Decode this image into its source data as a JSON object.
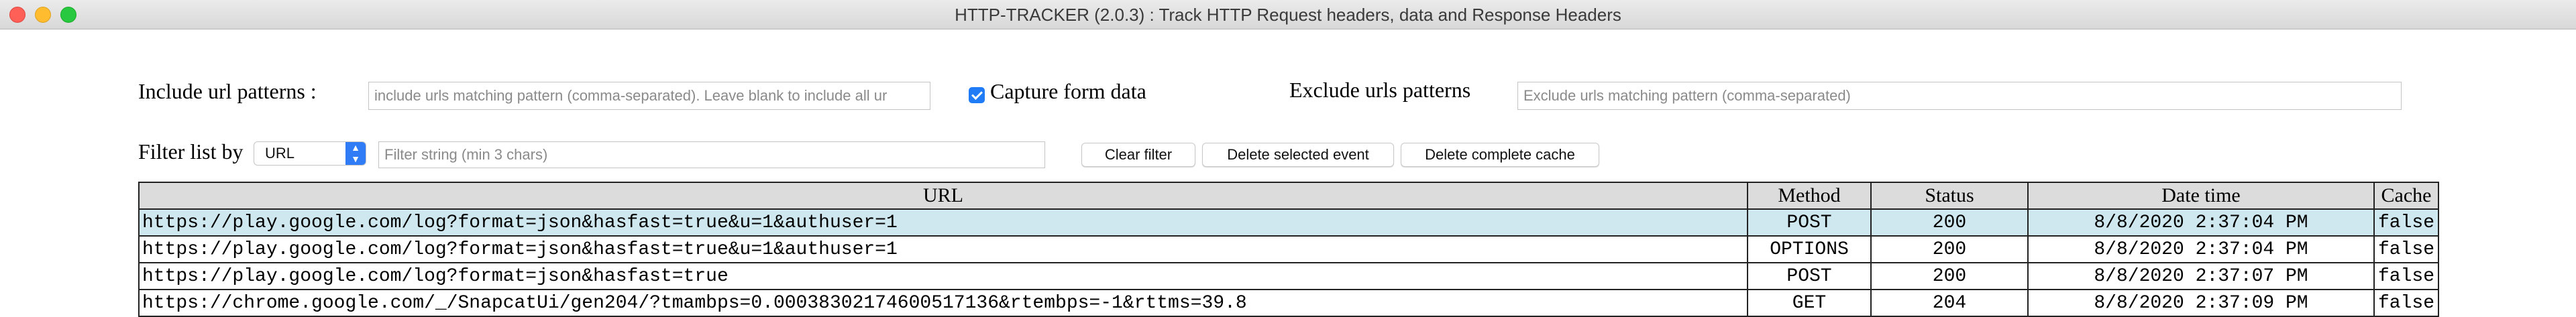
{
  "window": {
    "title": "HTTP-TRACKER (2.0.3) : Track HTTP Request headers, data and Response Headers"
  },
  "include": {
    "label": "Include url patterns :",
    "placeholder": "include urls matching pattern (comma-separated). Leave blank to include all ur",
    "value": ""
  },
  "capture": {
    "label": "Capture form data",
    "checked": true
  },
  "exclude": {
    "label": "Exclude urls patterns",
    "placeholder": "Exclude urls matching pattern (comma-separated)",
    "value": ""
  },
  "filter": {
    "label": "Filter list by",
    "selected": "URL",
    "placeholder": "Filter string (min 3 chars)",
    "value": ""
  },
  "buttons": {
    "clear_filter": "Clear filter",
    "delete_selected": "Delete selected event",
    "delete_cache": "Delete complete cache"
  },
  "table": {
    "headers": [
      "URL",
      "Method",
      "Status",
      "Date time",
      "Cache"
    ],
    "rows": [
      {
        "url": "https://play.google.com/log?format=json&hasfast=true&u=1&authuser=1",
        "method": "POST",
        "status": "200",
        "datetime": "8/8/2020 2:37:04 PM",
        "cache": "false",
        "selected": true
      },
      {
        "url": "https://play.google.com/log?format=json&hasfast=true&u=1&authuser=1",
        "method": "OPTIONS",
        "status": "200",
        "datetime": "8/8/2020 2:37:04 PM",
        "cache": "false",
        "selected": false
      },
      {
        "url": "https://play.google.com/log?format=json&hasfast=true",
        "method": "POST",
        "status": "200",
        "datetime": "8/8/2020 2:37:07 PM",
        "cache": "false",
        "selected": false
      },
      {
        "url": "https://chrome.google.com/_/SnapcatUi/gen204/?tmambps=0.0003830217460051713​6&rtembps=-1&rttms=39.8",
        "method": "GET",
        "status": "204",
        "datetime": "8/8/2020 2:37:09 PM",
        "cache": "false",
        "selected": false
      }
    ]
  }
}
